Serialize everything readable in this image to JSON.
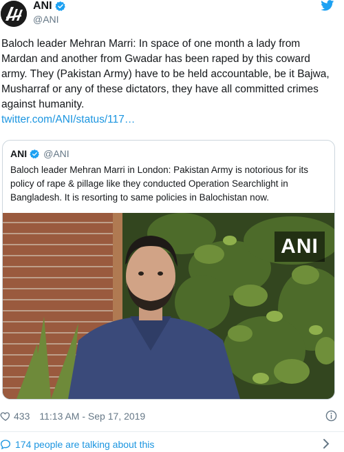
{
  "author": {
    "display_name": "ANI",
    "handle": "@ANI",
    "avatar_icon": "ani-logo-avatar",
    "verified": true
  },
  "brand": {
    "twitter_blue": "#1da1f2",
    "link_blue": "#1b95e0",
    "verified_blue": "#1da1f2"
  },
  "tweet": {
    "text": "Baloch leader Mehran Marri: In space of one month a lady from Mardan and another from Gwadar has been raped by this coward army. They (Pakistan Army) have to be held accountable, be it Bajwa, Musharraf or any of these dictators, they have all committed crimes against humanity.",
    "link": "twitter.com/ANI/status/117…"
  },
  "quoted_tweet": {
    "display_name": "ANI",
    "handle": "@ANI",
    "text": "Baloch leader Mehran Marri in London: Pakistan Army is notorious for its policy of rape & pillage like they conducted Operation Searchlight in Bangladesh. It is resorting to same policies in Balochistan now.",
    "video_watermark": "ANI"
  },
  "meta": {
    "likes": "433",
    "timestamp": "11:13 AM - Sep 17, 2019"
  },
  "footer": {
    "talking": "174 people are talking about this"
  }
}
